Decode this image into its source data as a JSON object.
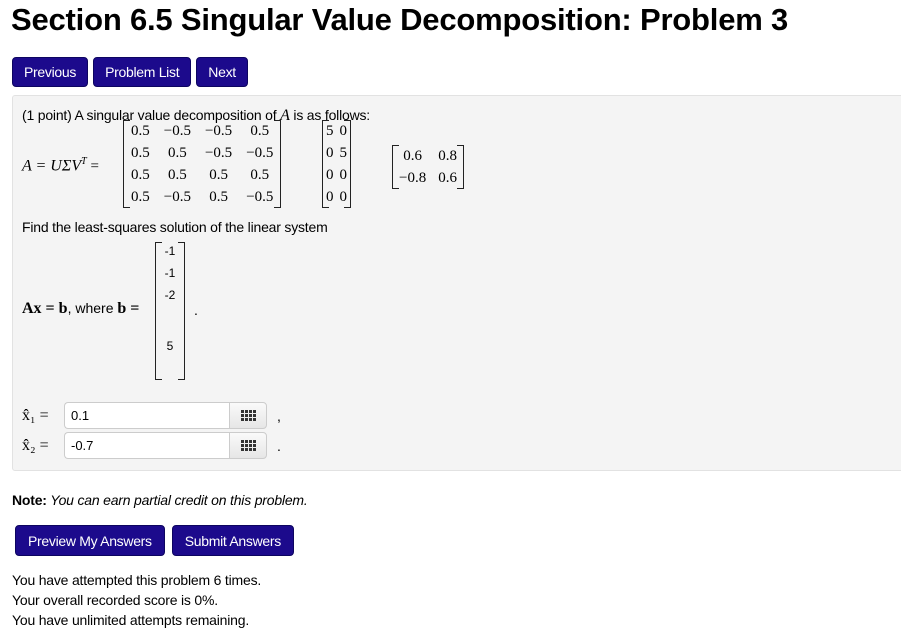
{
  "page": {
    "title": "Section 6.5 Singular Value Decomposition: Problem 3"
  },
  "nav": {
    "previous_label": "Previous",
    "problem_list_label": "Problem List",
    "next_label": "Next"
  },
  "problem": {
    "intro_prefix": "(1 point) A singular value decomposition of ",
    "intro_var": "A",
    "intro_suffix": " is as follows:",
    "svd_lhs": "A = UΣV",
    "svd_sup": "T",
    "svd_eq": " =",
    "U": [
      [
        "0.5",
        "−0.5",
        "−0.5",
        "0.5"
      ],
      [
        "0.5",
        "0.5",
        "−0.5",
        "−0.5"
      ],
      [
        "0.5",
        "0.5",
        "0.5",
        "0.5"
      ],
      [
        "0.5",
        "−0.5",
        "0.5",
        "−0.5"
      ]
    ],
    "Sigma": [
      [
        "5",
        "0"
      ],
      [
        "0",
        "5"
      ],
      [
        "0",
        "0"
      ],
      [
        "0",
        "0"
      ]
    ],
    "VT": [
      [
        "0.6",
        "0.8"
      ],
      [
        "−0.8",
        "0.6"
      ]
    ],
    "find_text": "Find the least-squares solution of the linear system",
    "system_lhs": "Ax = b",
    "system_where": ", where ",
    "system_b": "b =",
    "b": [
      "-1",
      "-1",
      "-2",
      "",
      "5",
      ""
    ],
    "b_period": ".",
    "answers": [
      {
        "label": "x̂₁ =",
        "value": "0.1",
        "punct": ","
      },
      {
        "label": "x̂₂ =",
        "value": "-0.7",
        "punct": "."
      }
    ]
  },
  "note": {
    "bold": "Note:",
    "text": " You can earn partial credit on this problem."
  },
  "actions": {
    "preview_label": "Preview My Answers",
    "submit_label": "Submit Answers"
  },
  "status": {
    "attempts": "You have attempted this problem 6 times.",
    "score": "Your overall recorded score is 0%.",
    "remaining": "You have unlimited attempts remaining."
  },
  "colors": {
    "button_bg": "#1c0a8c",
    "problem_bg": "#f4f4f4"
  }
}
